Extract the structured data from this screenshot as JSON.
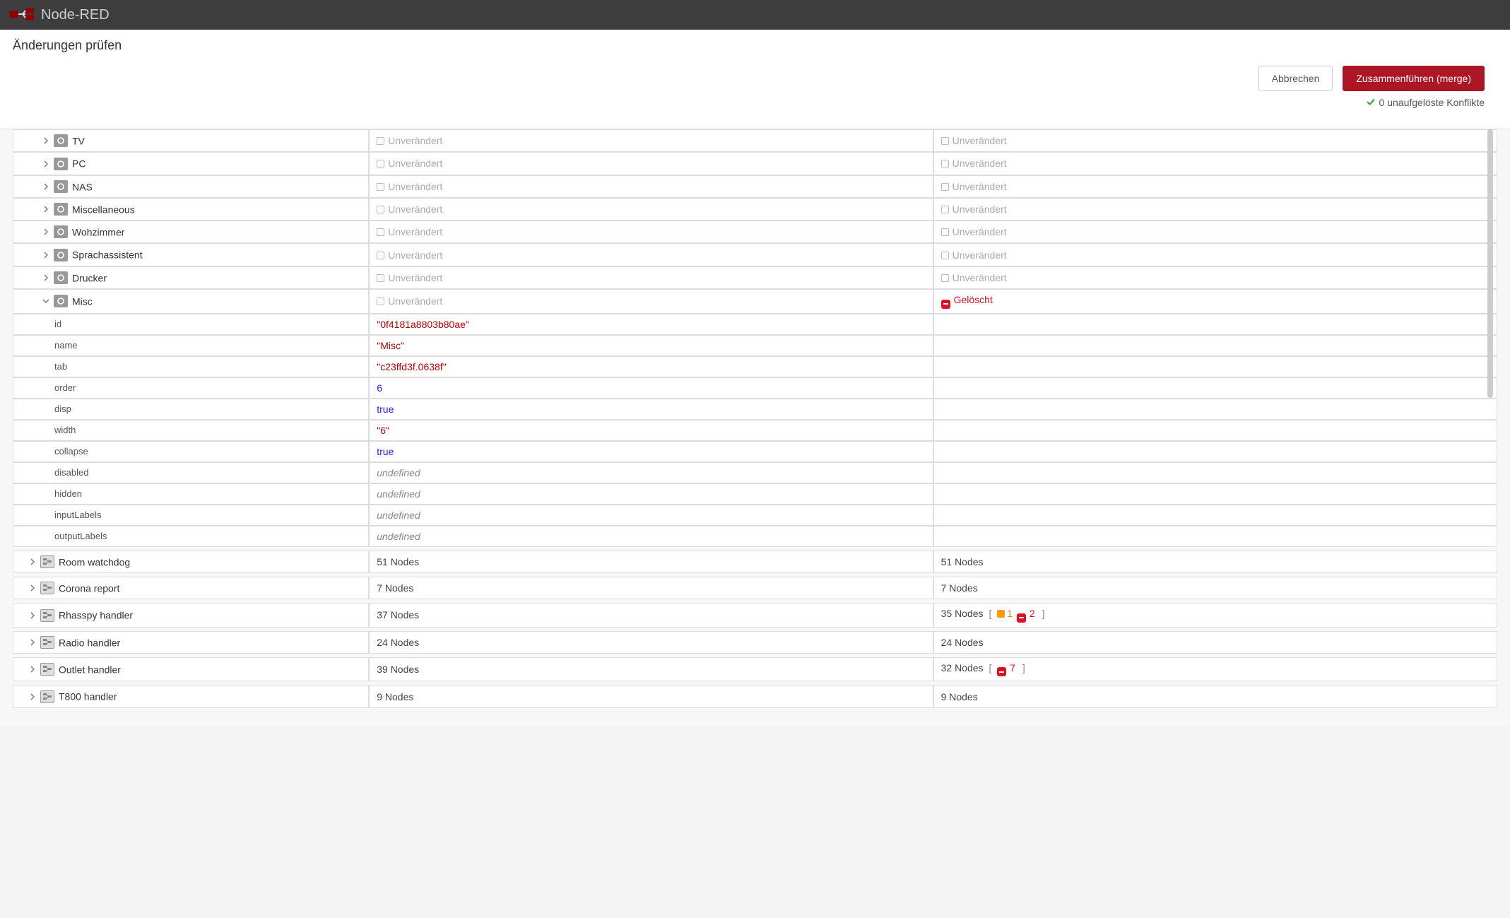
{
  "header": {
    "title": "Node-RED"
  },
  "dialog": {
    "title": "Änderungen prüfen",
    "cancel": "Abbrechen",
    "merge": "Zusammenführen (merge)",
    "conflicts": "0 unaufgelöste Konflikte"
  },
  "labels": {
    "unchanged": "Unverändert",
    "deleted": "Gelöscht",
    "nodes_suffix": "Nodes"
  },
  "groups": [
    {
      "name": "TV",
      "left": "Unverändert",
      "right": "Unverändert"
    },
    {
      "name": "PC",
      "left": "Unverändert",
      "right": "Unverändert"
    },
    {
      "name": "NAS",
      "left": "Unverändert",
      "right": "Unverändert"
    },
    {
      "name": "Miscellaneous",
      "left": "Unverändert",
      "right": "Unverändert"
    },
    {
      "name": "Wohzimmer",
      "left": "Unverändert",
      "right": "Unverändert"
    },
    {
      "name": "Sprachassistent",
      "left": "Unverändert",
      "right": "Unverändert"
    },
    {
      "name": "Drucker",
      "left": "Unverändert",
      "right": "Unverändert"
    }
  ],
  "misc": {
    "name": "Misc",
    "left": "Unverändert",
    "right": "Gelöscht",
    "props": [
      {
        "k": "id",
        "v": "\"0f4181a8803b80ae\"",
        "t": "str"
      },
      {
        "k": "name",
        "v": "\"Misc\"",
        "t": "str"
      },
      {
        "k": "tab",
        "v": "\"c23ffd3f.0638f\"",
        "t": "str"
      },
      {
        "k": "order",
        "v": "6",
        "t": "num"
      },
      {
        "k": "disp",
        "v": "true",
        "t": "bool"
      },
      {
        "k": "width",
        "v": "\"6\"",
        "t": "str"
      },
      {
        "k": "collapse",
        "v": "true",
        "t": "bool"
      },
      {
        "k": "disabled",
        "v": "undefined",
        "t": "undef"
      },
      {
        "k": "hidden",
        "v": "undefined",
        "t": "undef"
      },
      {
        "k": "inputLabels",
        "v": "undefined",
        "t": "undef"
      },
      {
        "k": "outputLabels",
        "v": "undefined",
        "t": "undef"
      }
    ]
  },
  "subflows": [
    {
      "name": "Room watchdog",
      "ln": "51",
      "rn": "51",
      "rc": null,
      "rd": null
    },
    {
      "name": "Corona report",
      "ln": "7",
      "rn": "7",
      "rc": null,
      "rd": null
    },
    {
      "name": "Rhasspy handler",
      "ln": "37",
      "rn": "35",
      "rc": "1",
      "rd": "2"
    },
    {
      "name": "Radio handler",
      "ln": "24",
      "rn": "24",
      "rc": null,
      "rd": null
    },
    {
      "name": "Outlet handler",
      "ln": "39",
      "rn": "32",
      "rc": null,
      "rd": "7"
    },
    {
      "name": "T800 handler",
      "ln": "9",
      "rn": "9",
      "rc": null,
      "rd": null
    }
  ]
}
